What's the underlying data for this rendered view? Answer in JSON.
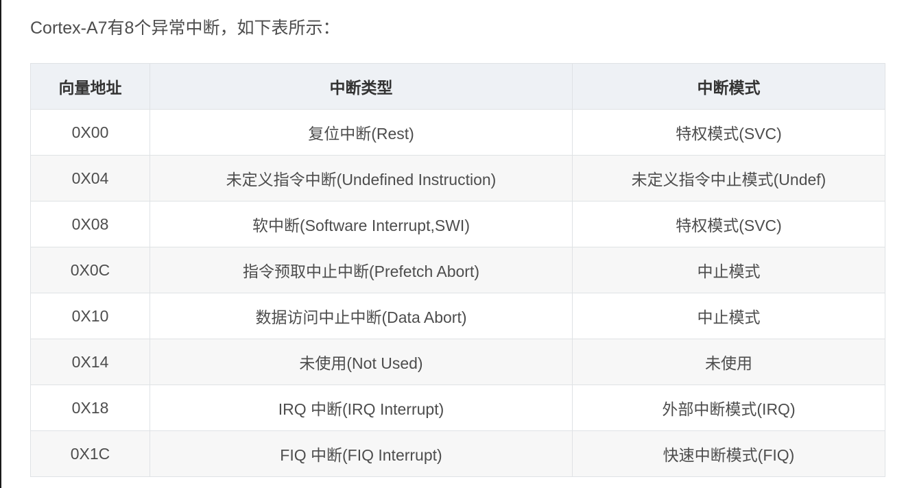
{
  "intro": "Cortex-A7有8个异常中断，如下表所示：",
  "table": {
    "headers": [
      "向量地址",
      "中断类型",
      "中断模式"
    ],
    "rows": [
      [
        "0X00",
        "复位中断(Rest)",
        "特权模式(SVC)"
      ],
      [
        "0X04",
        "未定义指令中断(Undefined Instruction)",
        "未定义指令中止模式(Undef)"
      ],
      [
        "0X08",
        "软中断(Software Interrupt,SWI)",
        "特权模式(SVC)"
      ],
      [
        "0X0C",
        "指令预取中止中断(Prefetch Abort)",
        "中止模式"
      ],
      [
        "0X10",
        "数据访问中止中断(Data Abort)",
        "中止模式"
      ],
      [
        "0X14",
        "未使用(Not Used)",
        "未使用"
      ],
      [
        "0X18",
        "IRQ 中断(IRQ Interrupt)",
        "外部中断模式(IRQ)"
      ],
      [
        "0X1C",
        "FIQ 中断(FIQ Interrupt)",
        "快速中断模式(FIQ)"
      ]
    ]
  }
}
